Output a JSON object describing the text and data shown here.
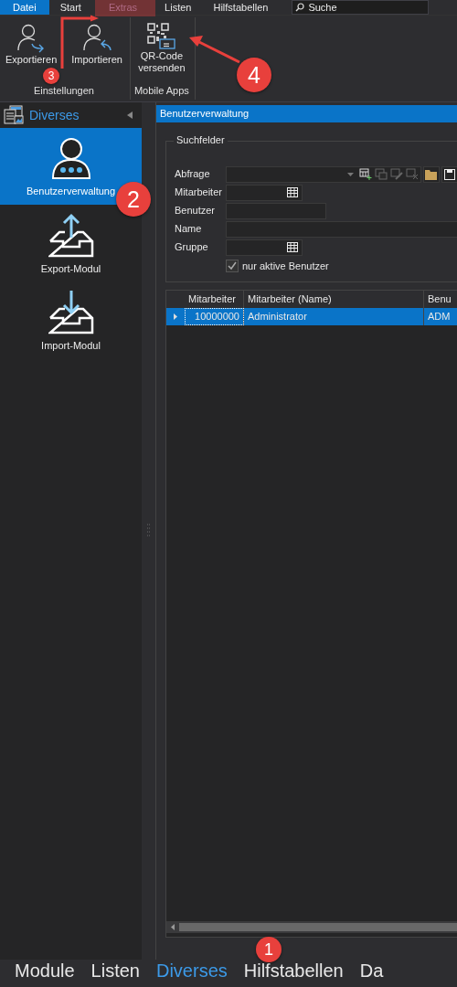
{
  "menu_tabs": [
    {
      "label": "Datei",
      "kind": "file",
      "selected": false
    },
    {
      "label": "Start",
      "kind": "tab",
      "selected": false
    },
    {
      "label": "Extras",
      "kind": "tab",
      "selected": true
    },
    {
      "label": "Listen",
      "kind": "tab",
      "selected": false
    },
    {
      "label": "Hilfstabellen",
      "kind": "tab",
      "selected": false
    }
  ],
  "search": {
    "placeholder": "Suche"
  },
  "ribbon_groups": [
    {
      "label": "Einstellungen",
      "buttons": [
        {
          "label": "Exportieren",
          "kind": "export"
        },
        {
          "label": "Importieren",
          "kind": "import"
        }
      ]
    },
    {
      "label": "Mobile Apps",
      "buttons": [
        {
          "label": "QR-Code\nversenden",
          "kind": "qr"
        }
      ]
    }
  ],
  "sidebar": {
    "title": "Diverses",
    "items": [
      {
        "label": "Benutzerverwaltung",
        "kind": "user",
        "selected": true
      },
      {
        "label": "Export-Modul",
        "kind": "export",
        "selected": false
      },
      {
        "label": "Import-Modul",
        "kind": "import",
        "selected": false
      }
    ]
  },
  "panel": {
    "title": "Benutzerverwaltung",
    "search_group": {
      "title": "Suchfelder",
      "fields": [
        {
          "label": "Abfrage",
          "kind": "query"
        },
        {
          "label": "Mitarbeiter",
          "kind": "lookup"
        },
        {
          "label": "Benutzer",
          "kind": "short"
        },
        {
          "label": "Name",
          "kind": "wide"
        },
        {
          "label": "Gruppe",
          "kind": "lookup"
        }
      ],
      "checkbox": {
        "label": "nur aktive Benutzer",
        "checked": true
      }
    },
    "table": {
      "columns": [
        "Mitarbeiter",
        "Mitarbeiter (Name)",
        "Benu"
      ],
      "rows": [
        {
          "cells": [
            "10000000",
            "Administrator",
            "ADM"
          ],
          "selected": true
        }
      ]
    }
  },
  "bottom_nav": [
    {
      "label": "Module",
      "selected": false
    },
    {
      "label": "Listen",
      "selected": false
    },
    {
      "label": "Diverses",
      "selected": true
    },
    {
      "label": "Hilfstabellen",
      "selected": false
    },
    {
      "label": "Da",
      "selected": false
    }
  ],
  "callouts": [
    "1",
    "2",
    "3",
    "4"
  ]
}
